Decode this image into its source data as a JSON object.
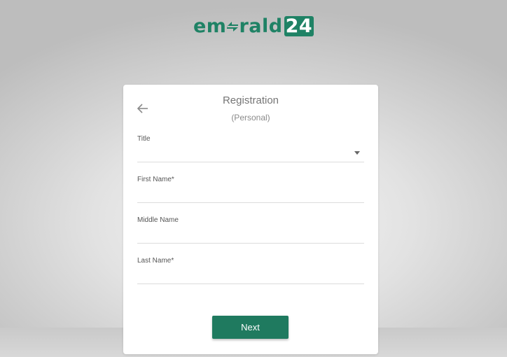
{
  "brand": {
    "logo_prefix": "em",
    "logo_suffix": "rald",
    "logo_badge": "24",
    "logo_e_icon": "double-arrow-e-icon",
    "color": "#1f8265"
  },
  "form": {
    "back_icon": "arrow-left-icon",
    "title": "Registration",
    "subtitle": "(Personal)",
    "fields": {
      "title": {
        "label": "Title",
        "value": ""
      },
      "first_name": {
        "label": "First Name*",
        "value": ""
      },
      "middle_name": {
        "label": "Middle Name",
        "value": ""
      },
      "last_name": {
        "label": "Last Name*",
        "value": ""
      }
    },
    "next_label": "Next",
    "button_color": "#1f7a5f"
  }
}
